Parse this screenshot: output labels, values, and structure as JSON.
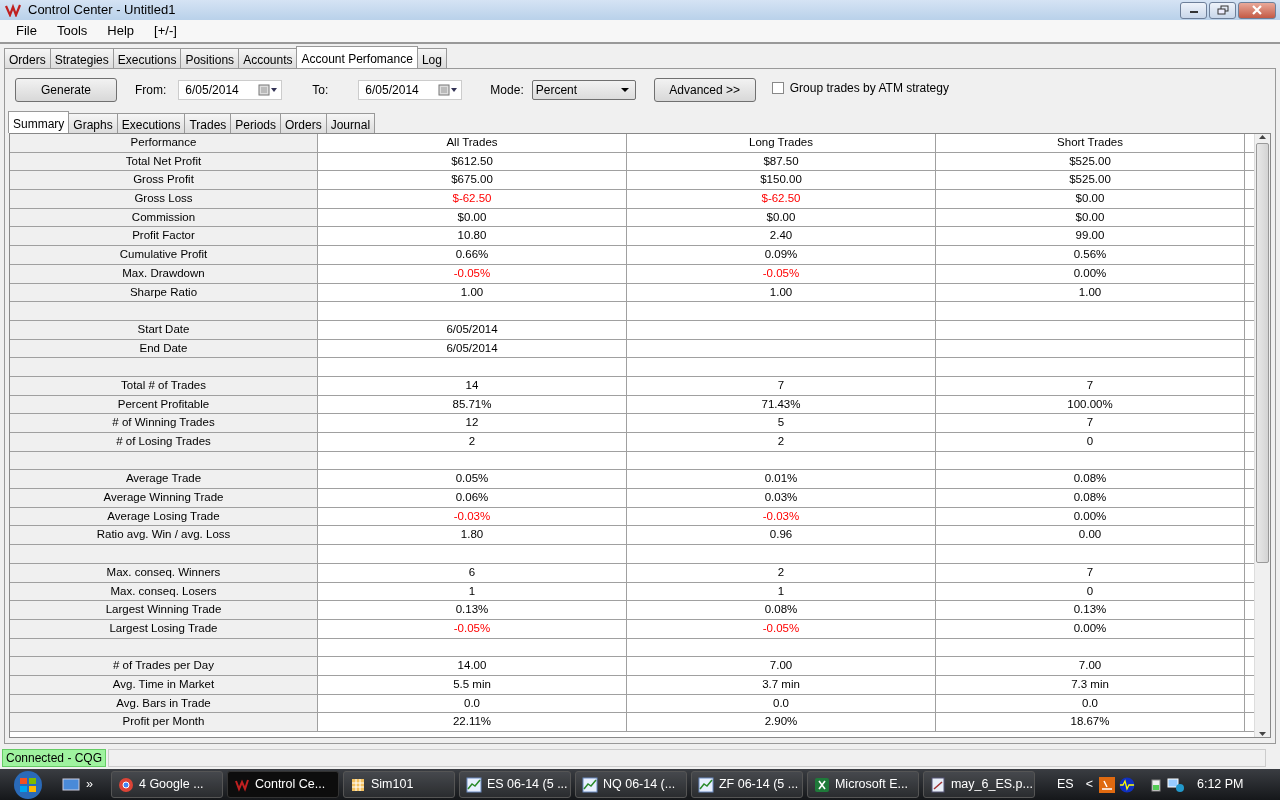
{
  "window": {
    "title": "Control Center - Untitled1"
  },
  "menu": [
    "File",
    "Tools",
    "Help",
    "[+/-]"
  ],
  "tabs": [
    {
      "label": "Orders",
      "selected": false
    },
    {
      "label": "Strategies",
      "selected": false
    },
    {
      "label": "Executions",
      "selected": false
    },
    {
      "label": "Positions",
      "selected": false
    },
    {
      "label": "Accounts",
      "selected": false
    },
    {
      "label": "Account Perfomance",
      "selected": true
    },
    {
      "label": "Log",
      "selected": false
    }
  ],
  "toolbar": {
    "generate": "Generate",
    "from_label": "From:",
    "from": "6/05/2014",
    "to_label": "To:",
    "to": "6/05/2014",
    "mode_label": "Mode:",
    "mode": "Percent",
    "advanced": "Advanced >>",
    "group_checkbox": {
      "label": "Group trades by ATM strategy",
      "checked": false
    }
  },
  "subtabs": [
    {
      "label": "Summary",
      "selected": true
    },
    {
      "label": "Graphs",
      "selected": false
    },
    {
      "label": "Executions",
      "selected": false
    },
    {
      "label": "Trades",
      "selected": false
    },
    {
      "label": "Periods",
      "selected": false
    },
    {
      "label": "Orders",
      "selected": false
    },
    {
      "label": "Journal",
      "selected": false
    }
  ],
  "table": {
    "columns": [
      "Performance",
      "All Trades",
      "Long Trades",
      "Short Trades"
    ],
    "rows": [
      {
        "kind": "stat",
        "label": "Total Net Profit",
        "values": [
          {
            "text": "$612.50",
            "negative": false
          },
          {
            "text": "$87.50",
            "negative": false
          },
          {
            "text": "$525.00",
            "negative": false
          }
        ]
      },
      {
        "kind": "stat",
        "label": "Gross Profit",
        "values": [
          {
            "text": "$675.00",
            "negative": false
          },
          {
            "text": "$150.00",
            "negative": false
          },
          {
            "text": "$525.00",
            "negative": false
          }
        ]
      },
      {
        "kind": "stat",
        "label": "Gross Loss",
        "values": [
          {
            "text": "$-62.50",
            "negative": true
          },
          {
            "text": "$-62.50",
            "negative": true
          },
          {
            "text": "$0.00",
            "negative": false
          }
        ]
      },
      {
        "kind": "stat",
        "label": "Commission",
        "values": [
          {
            "text": "$0.00",
            "negative": false
          },
          {
            "text": "$0.00",
            "negative": false
          },
          {
            "text": "$0.00",
            "negative": false
          }
        ]
      },
      {
        "kind": "stat",
        "label": "Profit Factor",
        "values": [
          {
            "text": "10.80",
            "negative": false
          },
          {
            "text": "2.40",
            "negative": false
          },
          {
            "text": "99.00",
            "negative": false
          }
        ]
      },
      {
        "kind": "stat",
        "label": "Cumulative Profit",
        "values": [
          {
            "text": "0.66%",
            "negative": false
          },
          {
            "text": "0.09%",
            "negative": false
          },
          {
            "text": "0.56%",
            "negative": false
          }
        ]
      },
      {
        "kind": "stat",
        "label": "Max. Drawdown",
        "values": [
          {
            "text": "-0.05%",
            "negative": true
          },
          {
            "text": "-0.05%",
            "negative": true
          },
          {
            "text": "0.00%",
            "negative": false
          }
        ]
      },
      {
        "kind": "stat",
        "label": "Sharpe Ratio",
        "values": [
          {
            "text": "1.00",
            "negative": false
          },
          {
            "text": "1.00",
            "negative": false
          },
          {
            "text": "1.00",
            "negative": false
          }
        ]
      },
      {
        "kind": "blank"
      },
      {
        "kind": "stat",
        "label": "Start Date",
        "values": [
          {
            "text": "6/05/2014",
            "negative": false
          }
        ]
      },
      {
        "kind": "stat",
        "label": "End Date",
        "values": [
          {
            "text": "6/05/2014",
            "negative": false
          }
        ]
      },
      {
        "kind": "blank"
      },
      {
        "kind": "stat",
        "label": "Total # of Trades",
        "values": [
          {
            "text": "14",
            "negative": false
          },
          {
            "text": "7",
            "negative": false
          },
          {
            "text": "7",
            "negative": false
          }
        ]
      },
      {
        "kind": "stat",
        "label": "Percent Profitable",
        "values": [
          {
            "text": "85.71%",
            "negative": false
          },
          {
            "text": "71.43%",
            "negative": false
          },
          {
            "text": "100.00%",
            "negative": false
          }
        ]
      },
      {
        "kind": "stat",
        "label": "# of Winning Trades",
        "values": [
          {
            "text": "12",
            "negative": false
          },
          {
            "text": "5",
            "negative": false
          },
          {
            "text": "7",
            "negative": false
          }
        ]
      },
      {
        "kind": "stat",
        "label": "# of Losing Trades",
        "values": [
          {
            "text": "2",
            "negative": false
          },
          {
            "text": "2",
            "negative": false
          },
          {
            "text": "0",
            "negative": false
          }
        ]
      },
      {
        "kind": "blank"
      },
      {
        "kind": "stat",
        "label": "Average Trade",
        "values": [
          {
            "text": "0.05%",
            "negative": false
          },
          {
            "text": "0.01%",
            "negative": false
          },
          {
            "text": "0.08%",
            "negative": false
          }
        ]
      },
      {
        "kind": "stat",
        "label": "Average Winning Trade",
        "values": [
          {
            "text": "0.06%",
            "negative": false
          },
          {
            "text": "0.03%",
            "negative": false
          },
          {
            "text": "0.08%",
            "negative": false
          }
        ]
      },
      {
        "kind": "stat",
        "label": "Average Losing Trade",
        "values": [
          {
            "text": "-0.03%",
            "negative": true
          },
          {
            "text": "-0.03%",
            "negative": true
          },
          {
            "text": "0.00%",
            "negative": false
          }
        ]
      },
      {
        "kind": "stat",
        "label": "Ratio avg. Win / avg. Loss",
        "values": [
          {
            "text": "1.80",
            "negative": false
          },
          {
            "text": "0.96",
            "negative": false
          },
          {
            "text": "0.00",
            "negative": false
          }
        ]
      },
      {
        "kind": "blank"
      },
      {
        "kind": "stat",
        "label": "Max. conseq. Winners",
        "values": [
          {
            "text": "6",
            "negative": false
          },
          {
            "text": "2",
            "negative": false
          },
          {
            "text": "7",
            "negative": false
          }
        ]
      },
      {
        "kind": "stat",
        "label": "Max. conseq. Losers",
        "values": [
          {
            "text": "1",
            "negative": false
          },
          {
            "text": "1",
            "negative": false
          },
          {
            "text": "0",
            "negative": false
          }
        ]
      },
      {
        "kind": "stat",
        "label": "Largest Winning Trade",
        "values": [
          {
            "text": "0.13%",
            "negative": false
          },
          {
            "text": "0.08%",
            "negative": false
          },
          {
            "text": "0.13%",
            "negative": false
          }
        ]
      },
      {
        "kind": "stat",
        "label": "Largest Losing Trade",
        "values": [
          {
            "text": "-0.05%",
            "negative": true
          },
          {
            "text": "-0.05%",
            "negative": true
          },
          {
            "text": "0.00%",
            "negative": false
          }
        ]
      },
      {
        "kind": "blank"
      },
      {
        "kind": "stat",
        "label": "# of Trades per Day",
        "values": [
          {
            "text": "14.00",
            "negative": false
          },
          {
            "text": "7.00",
            "negative": false
          },
          {
            "text": "7.00",
            "negative": false
          }
        ]
      },
      {
        "kind": "stat",
        "label": "Avg. Time in Market",
        "values": [
          {
            "text": "5.5 min",
            "negative": false
          },
          {
            "text": "3.7 min",
            "negative": false
          },
          {
            "text": "7.3 min",
            "negative": false
          }
        ]
      },
      {
        "kind": "stat",
        "label": "Avg. Bars in Trade",
        "values": [
          {
            "text": "0.0",
            "negative": false
          },
          {
            "text": "0.0",
            "negative": false
          },
          {
            "text": "0.0",
            "negative": false
          }
        ]
      },
      {
        "kind": "stat",
        "label": "Profit per Month",
        "values": [
          {
            "text": "22.11%",
            "negative": false
          },
          {
            "text": "2.90%",
            "negative": false
          },
          {
            "text": "18.67%",
            "negative": false
          }
        ]
      }
    ]
  },
  "status_bar": {
    "connection": "Connected - CQG"
  },
  "taskbar": {
    "items": [
      {
        "label": "4 Google ...",
        "kind": "chrome",
        "selected": false
      },
      {
        "label": "Control Ce...",
        "kind": "nt",
        "selected": true
      },
      {
        "label": "Sim101",
        "kind": "grid",
        "selected": false
      },
      {
        "label": "ES 06-14 (5 ...",
        "kind": "chart",
        "selected": false
      },
      {
        "label": "NQ 06-14 (...",
        "kind": "chart",
        "selected": false
      },
      {
        "label": "ZF 06-14 (5 ...",
        "kind": "chart",
        "selected": false
      },
      {
        "label": "Microsoft E...",
        "kind": "excel",
        "selected": false
      },
      {
        "label": "may_6_ES.p...",
        "kind": "paint",
        "selected": false
      }
    ],
    "quicklaunch": "»",
    "language": "ES",
    "tray_arrow": "<",
    "clock": "6:12 PM"
  }
}
